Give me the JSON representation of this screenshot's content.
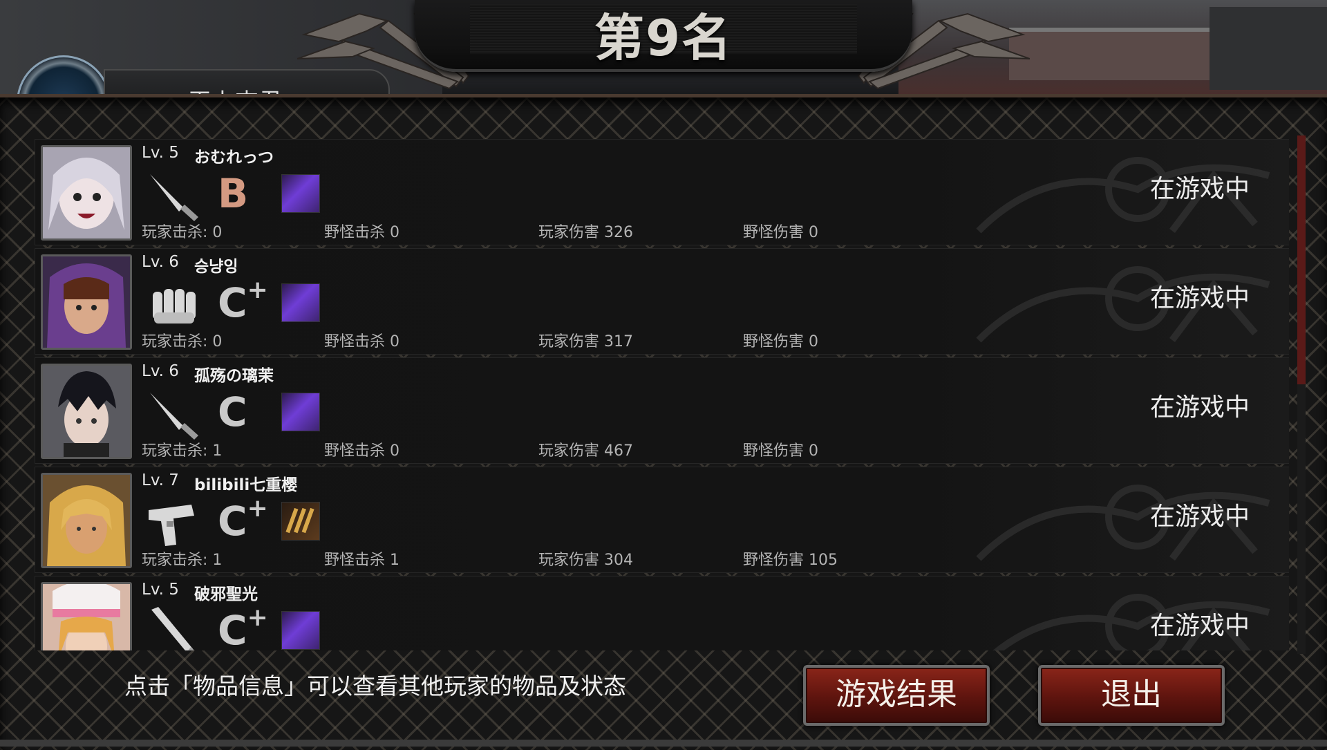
{
  "header": {
    "rank_title": "第9名",
    "side_tab_text": "王上吉君"
  },
  "players": [
    {
      "level": "Lv. 5",
      "name": "おむれっつ",
      "weapon_icon": "knife-icon",
      "grade": "B",
      "grade_plus": "",
      "item_icon": "purple-gem-icon",
      "item_color": "#6f3dd6",
      "player_kills": "玩家击杀: 0",
      "monster_kills": "野怪击杀 0",
      "player_damage": "玩家伤害 326",
      "monster_damage": "野怪伤害 0",
      "status": "在游戏中"
    },
    {
      "level": "Lv. 6",
      "name": "승냥잉",
      "weapon_icon": "glove-fist-icon",
      "grade": "C",
      "grade_plus": "+",
      "item_icon": "purple-gem-icon",
      "item_color": "#6f3dd6",
      "player_kills": "玩家击杀: 0",
      "monster_kills": "野怪击杀 0",
      "player_damage": "玩家伤害 317",
      "monster_damage": "野怪伤害 0",
      "status": "在游戏中"
    },
    {
      "level": "Lv. 6",
      "name": "孤殇の璃茉",
      "weapon_icon": "knife-icon",
      "grade": "C",
      "grade_plus": "",
      "item_icon": "purple-gem-icon",
      "item_color": "#6f3dd6",
      "player_kills": "玩家击杀: 1",
      "monster_kills": "野怪击杀 0",
      "player_damage": "玩家伤害 467",
      "monster_damage": "野怪伤害 0",
      "status": "在游戏中"
    },
    {
      "level": "Lv. 7",
      "name": "bilibili七重樱",
      "weapon_icon": "pistol-icon",
      "grade": "C",
      "grade_plus": "+",
      "item_icon": "bullets-icon",
      "item_color": "#5c3b1e",
      "player_kills": "玩家击杀: 1",
      "monster_kills": "野怪击杀 1",
      "player_damage": "玩家伤害 304",
      "monster_damage": "野怪伤害 105",
      "status": "在游戏中"
    },
    {
      "level": "Lv. 5",
      "name": "破邪聖光",
      "weapon_icon": "bat-icon",
      "grade": "C",
      "grade_plus": "+",
      "item_icon": "purple-gem-icon",
      "item_color": "#6f3dd6",
      "player_kills": "",
      "monster_kills": "",
      "player_damage": "",
      "monster_damage": "",
      "status": "在游戏中"
    }
  ],
  "footer": {
    "tip": "点击「物品信息」可以查看其他玩家的物品及状态",
    "result_button": "游戏结果",
    "exit_button": "退出"
  },
  "colors": {
    "button_red": "#8a2519",
    "grade_b": "#d49a82",
    "accent_purple": "#6f3dd6"
  }
}
